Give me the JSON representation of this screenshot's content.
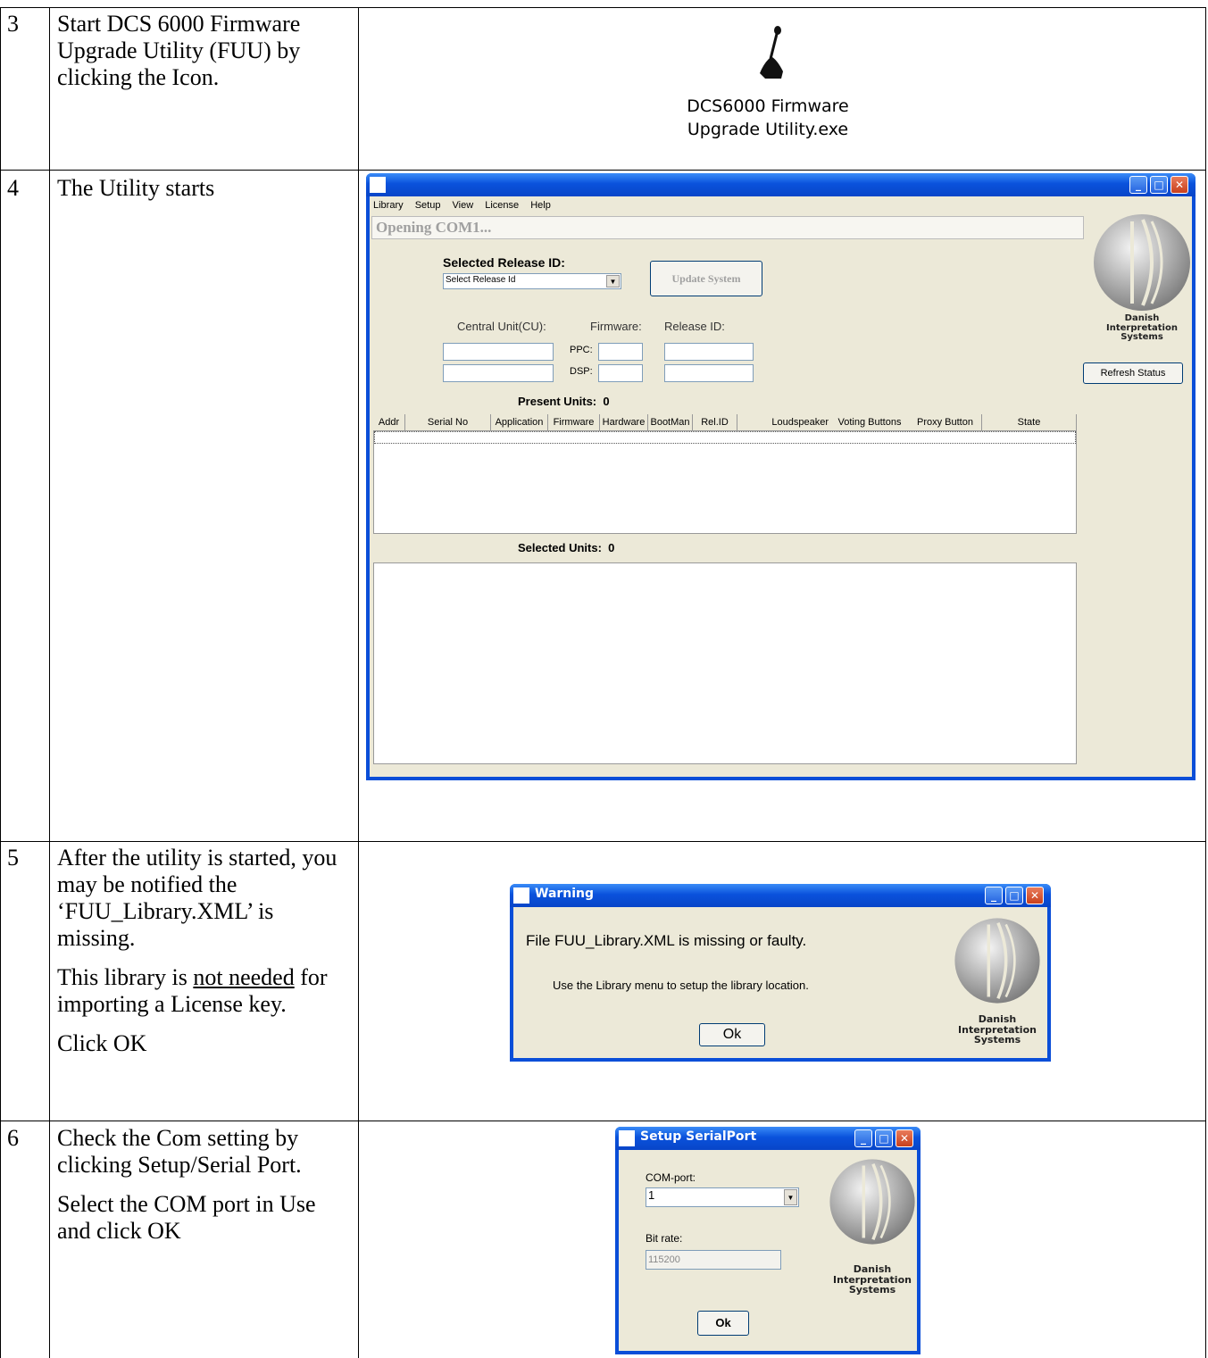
{
  "rows": [
    {
      "num": "3",
      "lines": [
        "Start DCS 6000 Firmware Upgrade Utility (FUU) by clicking the Icon."
      ]
    },
    {
      "num": "4",
      "lines": [
        "The Utility starts"
      ]
    },
    {
      "num": "5",
      "lines": [
        "After the utility is started, you may be notified the ‘FUU_Library.XML’ is missing."
      ],
      "line2_pre": "This library is ",
      "line2_u": "not needed",
      "line2_post": " for importing a License key.",
      "line3": "Click OK"
    },
    {
      "num": "6",
      "lines": [
        "Check the Com setting by clicking Setup/Serial Port.",
        "Select the COM port in Use and click OK"
      ]
    }
  ],
  "desktop_icon": {
    "label_line1": "DCS6000 Firmware",
    "label_line2": "Upgrade Utility.exe",
    "icon": "microphone-icon"
  },
  "main_window": {
    "menu": [
      "Library",
      "Setup",
      "View",
      "License",
      "Help"
    ],
    "status": "Opening COM1...",
    "selected_release_label": "Selected Release ID:",
    "release_combo": "Select Release Id",
    "update_button": "Update System",
    "cu_label": "Central Unit(CU):",
    "firmware_label": "Firmware:",
    "release_id_label": "Release ID:",
    "ppc_label": "PPC:",
    "dsp_label": "DSP:",
    "present_units": "Present Units:  0",
    "columns": [
      "Addr",
      "Serial No",
      "Application",
      "Firmware",
      "Hardware",
      "BootMan",
      "Rel.ID",
      "Loudspeaker",
      "Voting Buttons",
      "Proxy Button",
      "State"
    ],
    "selected_units": "Selected Units:  0",
    "refresh_button": "Refresh Status"
  },
  "logo": {
    "line1": "Danish",
    "line2": "Interpretation",
    "line3": "Systems"
  },
  "warning_window": {
    "title": "Warning",
    "message": "File FUU_Library.XML is missing or faulty.",
    "hint": "Use the Library menu to setup the library location.",
    "ok": "Ok"
  },
  "serial_window": {
    "title": "Setup SerialPort",
    "com_label": "COM-port:",
    "com_value": "1",
    "bitrate_label": "Bit rate:",
    "bitrate_value": "115200",
    "ok": "Ok"
  },
  "colors": {
    "titlebar": "#0a52dc",
    "window_bg": "#ece9d8",
    "close": "#c9401c"
  }
}
